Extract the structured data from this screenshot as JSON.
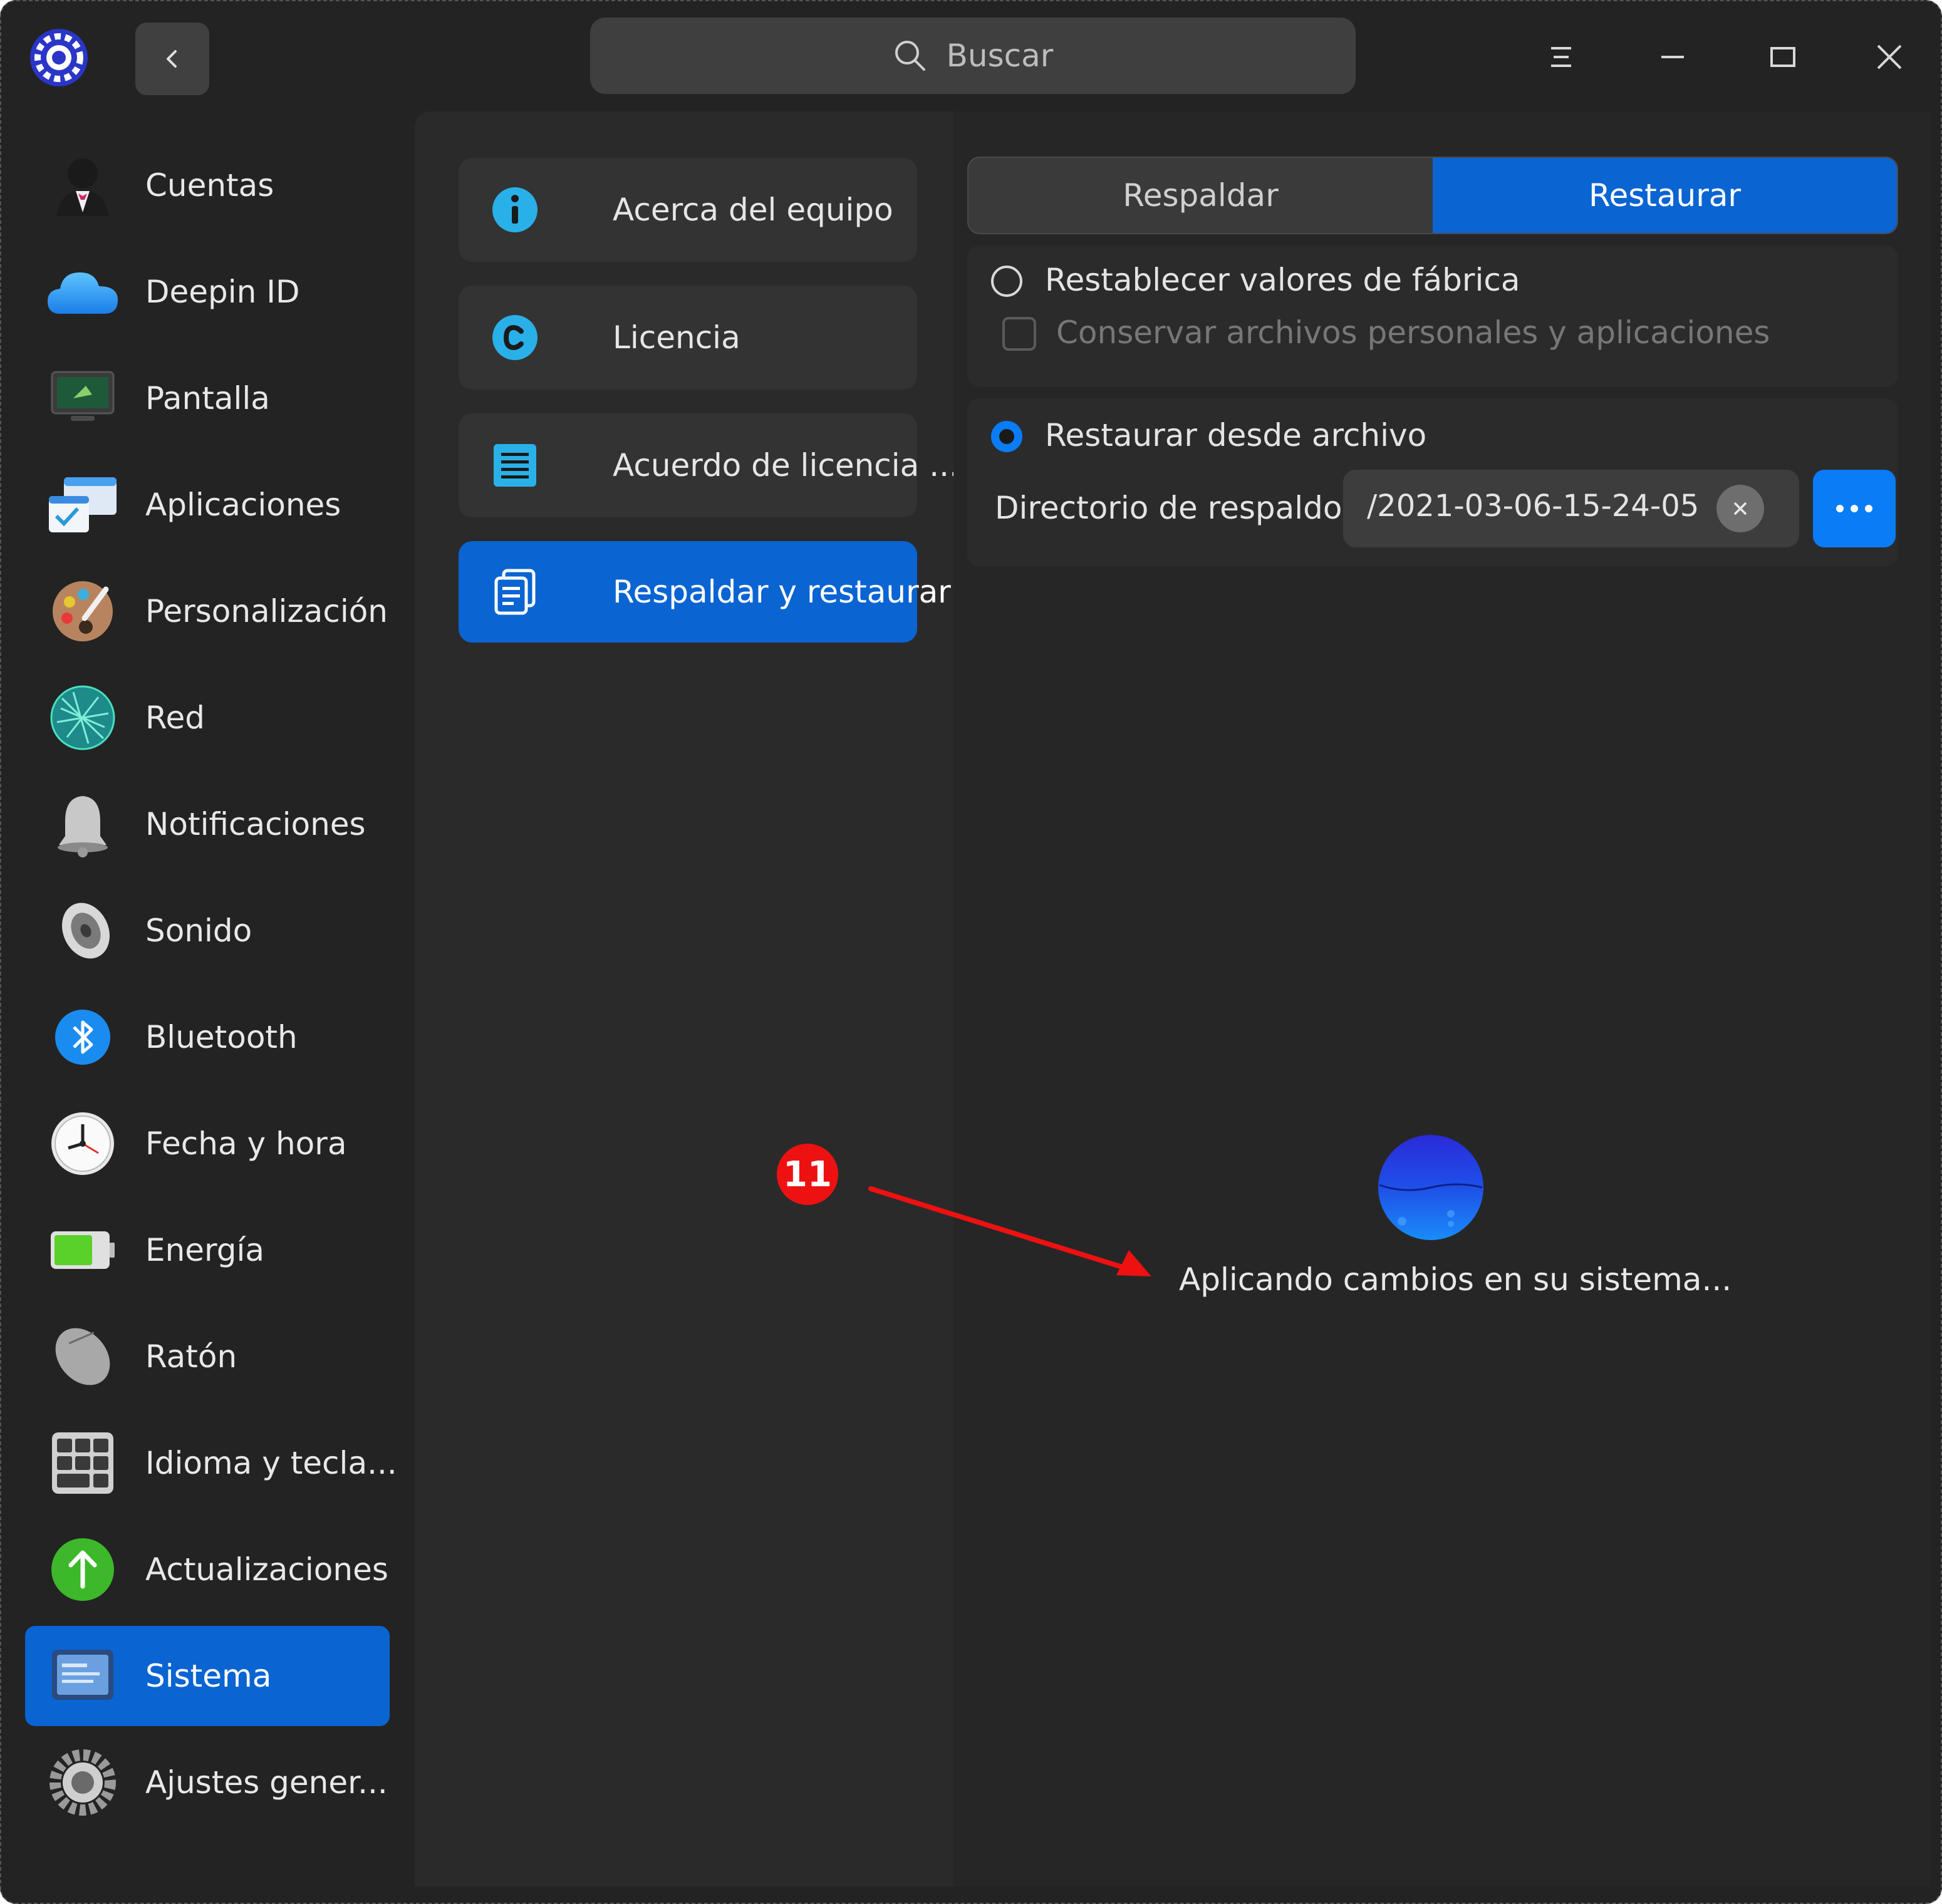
{
  "colors": {
    "background": "#232323",
    "accent": "#0a64d2",
    "accent_bright": "#0a7cf5",
    "annotation": "#ee1111"
  },
  "titlebar": {
    "search_placeholder": "Buscar",
    "icons": [
      "app-logo-icon",
      "back-icon",
      "search-icon",
      "menu-icon",
      "minimize-icon",
      "maximize-icon",
      "close-icon"
    ]
  },
  "sidebar": {
    "items": [
      {
        "label": "Cuentas",
        "icon": "accounts-icon"
      },
      {
        "label": "Deepin ID",
        "icon": "cloud-icon"
      },
      {
        "label": "Pantalla",
        "icon": "display-icon"
      },
      {
        "label": "Aplicaciones",
        "icon": "applications-icon"
      },
      {
        "label": "Personalización",
        "icon": "palette-icon"
      },
      {
        "label": "Red",
        "icon": "network-icon"
      },
      {
        "label": "Notificaciones",
        "icon": "bell-icon"
      },
      {
        "label": "Sonido",
        "icon": "speaker-icon"
      },
      {
        "label": "Bluetooth",
        "icon": "bluetooth-icon"
      },
      {
        "label": "Fecha y hora",
        "icon": "clock-icon"
      },
      {
        "label": "Energía",
        "icon": "battery-icon"
      },
      {
        "label": "Ratón",
        "icon": "mouse-icon"
      },
      {
        "label": "Idioma y tecla...",
        "icon": "keyboard-icon"
      },
      {
        "label": "Actualizaciones",
        "icon": "update-icon"
      },
      {
        "label": "Sistema",
        "icon": "system-icon",
        "active": true
      },
      {
        "label": "Ajustes gener...",
        "icon": "gear-icon"
      }
    ]
  },
  "middle": {
    "items": [
      {
        "label": "Acerca del equipo",
        "icon": "info-icon"
      },
      {
        "label": "Licencia",
        "icon": "copyright-icon"
      },
      {
        "label": "Acuerdo de licencia ...",
        "icon": "document-icon"
      },
      {
        "label": "Respaldar y restaurar",
        "icon": "backup-icon",
        "active": true
      }
    ]
  },
  "right": {
    "tabs": [
      {
        "label": "Respaldar",
        "active": false
      },
      {
        "label": "Restaurar",
        "active": true
      }
    ],
    "factory": {
      "label": "Restablecer valores de fábrica",
      "checkbox_label": "Conservar archivos personales y aplicaciones",
      "selected": false,
      "checked": false
    },
    "from_file": {
      "label": "Restaurar desde archivo",
      "selected": true,
      "dir_label": "Directorio de respaldo",
      "dir_value": "/2021-03-06-15-24-05",
      "more_label": "•••"
    },
    "status": "Aplicando cambios en su sistema..."
  },
  "annotation": {
    "badge": "11"
  }
}
